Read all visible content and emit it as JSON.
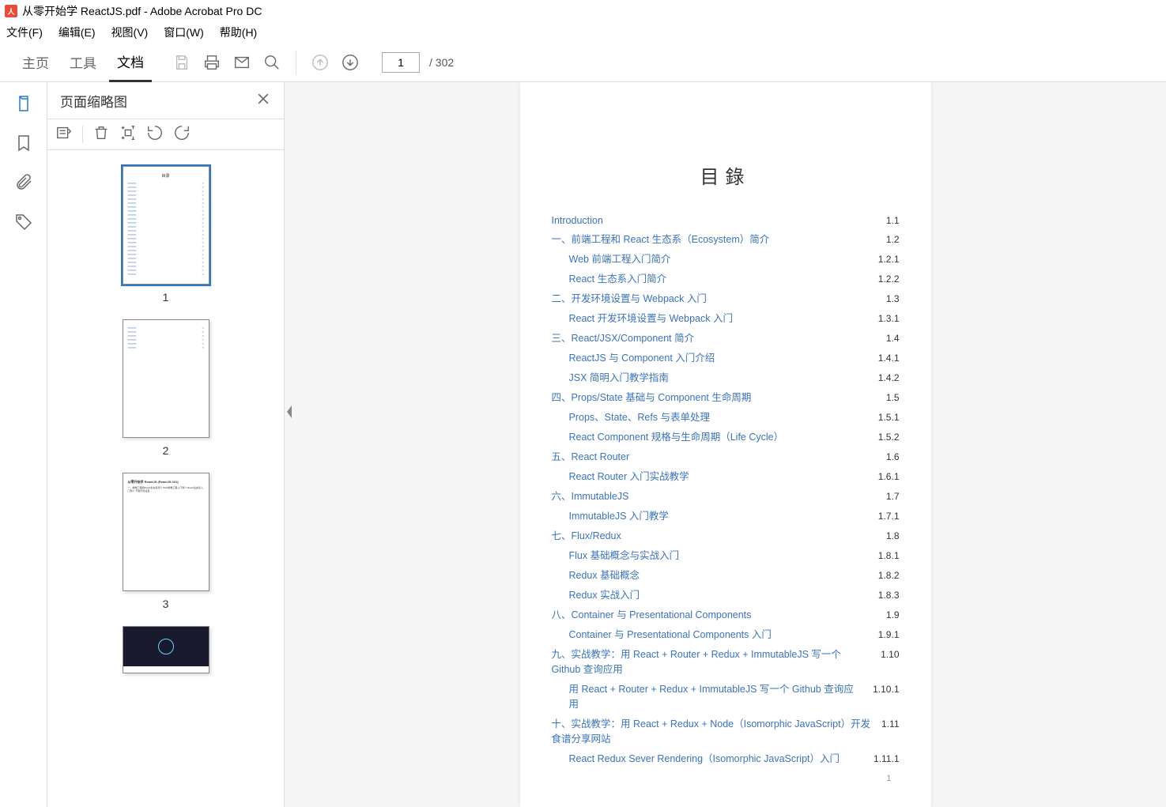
{
  "window": {
    "title": "从零开始学 ReactJS.pdf - Adobe Acrobat Pro DC"
  },
  "menu": {
    "file": "文件(F)",
    "edit": "编辑(E)",
    "view": "视图(V)",
    "window": "窗口(W)",
    "help": "帮助(H)"
  },
  "tabs": {
    "home": "主页",
    "tools": "工具",
    "document": "文档"
  },
  "nav": {
    "current_page": "1",
    "total_pages": "/ 302"
  },
  "panel": {
    "title": "页面缩略图"
  },
  "thumbs": [
    "1",
    "2",
    "3"
  ],
  "doc": {
    "toc_title": "目錄",
    "page_footer": "1",
    "entries": [
      {
        "lvl": 1,
        "title": "Introduction",
        "num": "1.1"
      },
      {
        "lvl": 1,
        "title": "一、前端工程和 React 生态系（Ecosystem）简介",
        "num": "1.2"
      },
      {
        "lvl": 2,
        "title": "Web 前端工程入门简介",
        "num": "1.2.1"
      },
      {
        "lvl": 2,
        "title": "React 生态系入门简介",
        "num": "1.2.2"
      },
      {
        "lvl": 1,
        "title": "二、开发环境设置与 Webpack 入门",
        "num": "1.3"
      },
      {
        "lvl": 2,
        "title": "React 开发环境设置与 Webpack 入门",
        "num": "1.3.1"
      },
      {
        "lvl": 1,
        "title": "三、React/JSX/Component 简介",
        "num": "1.4"
      },
      {
        "lvl": 2,
        "title": "ReactJS 与 Component 入门介绍",
        "num": "1.4.1"
      },
      {
        "lvl": 2,
        "title": "JSX 简明入门教学指南",
        "num": "1.4.2"
      },
      {
        "lvl": 1,
        "title": "四、Props/State 基础与 Component 生命周期",
        "num": "1.5"
      },
      {
        "lvl": 2,
        "title": "Props、State、Refs 与表单处理",
        "num": "1.5.1"
      },
      {
        "lvl": 2,
        "title": "React Component 规格与生命周期（Life Cycle）",
        "num": "1.5.2"
      },
      {
        "lvl": 1,
        "title": "五、React Router",
        "num": "1.6"
      },
      {
        "lvl": 2,
        "title": "React Router 入门实战教学",
        "num": "1.6.1"
      },
      {
        "lvl": 1,
        "title": "六、ImmutableJS",
        "num": "1.7"
      },
      {
        "lvl": 2,
        "title": "ImmutableJS 入门教学",
        "num": "1.7.1"
      },
      {
        "lvl": 1,
        "title": "七、Flux/Redux",
        "num": "1.8"
      },
      {
        "lvl": 2,
        "title": "Flux 基础概念与实战入门",
        "num": "1.8.1"
      },
      {
        "lvl": 2,
        "title": "Redux 基础概念",
        "num": "1.8.2"
      },
      {
        "lvl": 2,
        "title": "Redux 实战入门",
        "num": "1.8.3"
      },
      {
        "lvl": 1,
        "title": "八、Container 与 Presentational Components",
        "num": "1.9"
      },
      {
        "lvl": 2,
        "title": "Container 与 Presentational Components 入门",
        "num": "1.9.1"
      },
      {
        "lvl": 1,
        "title": "九、实战教学：用 React + Router + Redux + ImmutableJS 写一个 Github 查询应用",
        "num": "1.10"
      },
      {
        "lvl": 2,
        "title": "用 React + Router + Redux + ImmutableJS 写一个 Github 查询应用",
        "num": "1.10.1"
      },
      {
        "lvl": 1,
        "title": "十、实战教学：用 React + Redux + Node（Isomorphic JavaScript）开发食谱分享网站",
        "num": "1.11"
      },
      {
        "lvl": 2,
        "title": "React Redux Sever Rendering（Isomorphic JavaScript）入门",
        "num": "1.11.1"
      }
    ]
  }
}
